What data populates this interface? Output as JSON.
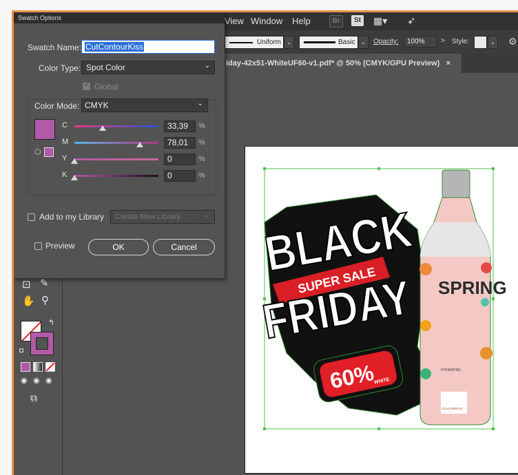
{
  "menu": {
    "view": "View",
    "window": "Window",
    "help": "Help",
    "br": "Br",
    "st": "St"
  },
  "control_bar": {
    "stroke_profile": "Uniform",
    "brush": "Basic",
    "opacity_label": "Opacity:",
    "opacity_value": "100%",
    "style_label": "Style:"
  },
  "document_tab": {
    "title": "iday-42x51-WhiteUF60-v1.pdf* @ 50% (CMYK/GPU Preview)",
    "close": "×"
  },
  "dialog": {
    "title": "Swatch Options",
    "swatch_name_label": "Swatch Name:",
    "swatch_name_value": "CutContourKiss",
    "color_type_label": "Color Type:",
    "color_type_value": "Spot Color",
    "global_label": "Global",
    "color_mode_label": "Color Mode:",
    "color_mode_value": "CMYK",
    "swatch_color": "#b25aa8",
    "channels": [
      {
        "label": "C",
        "value": "33,39",
        "unit": "%",
        "level": 0.3339
      },
      {
        "label": "M",
        "value": "78,01",
        "unit": "%",
        "level": 0.7801
      },
      {
        "label": "Y",
        "value": "0",
        "unit": "%",
        "level": 0
      },
      {
        "label": "K",
        "value": "0",
        "unit": "%",
        "level": 0
      }
    ],
    "add_to_library_label": "Add to my Library",
    "library_placeholder": "Create New Library...",
    "preview_label": "Preview",
    "ok_label": "OK",
    "cancel_label": "Cancel"
  },
  "artwork": {
    "line1": "BLACK",
    "banner": "SUPER SALE",
    "line2": "FRIDAY",
    "percent": "60%",
    "white": "WHITE",
    "bottle_word": "SPRING",
    "bottle_sub": "HYDRATING",
    "brand": "EQUILIBRIUM"
  },
  "colors": {
    "accent_fill": "#b25aa8",
    "frame": "#e8914a",
    "red": "#e01f27"
  }
}
